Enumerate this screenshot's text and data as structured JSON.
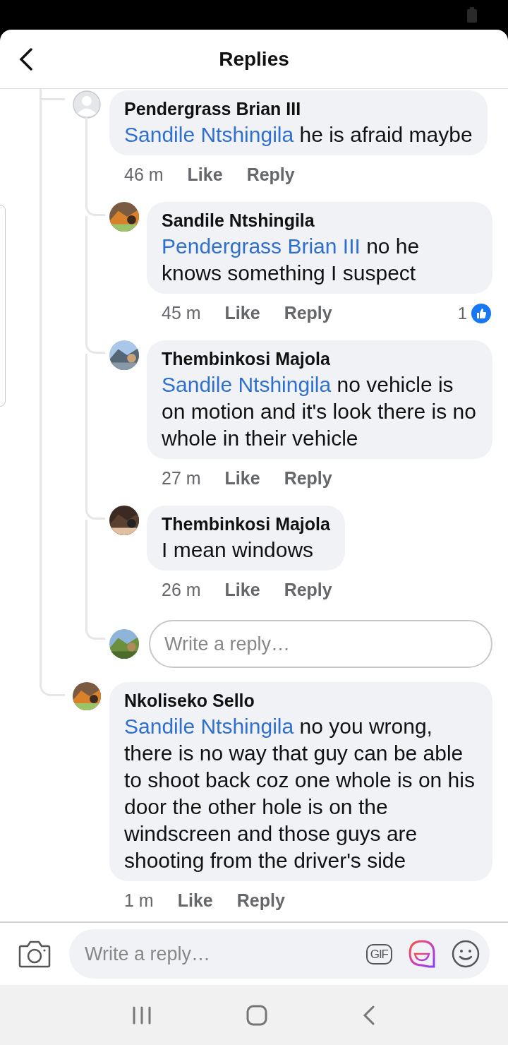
{
  "header": {
    "title": "Replies"
  },
  "comments": [
    {
      "has_photo": false,
      "author": "Pendergrass Brian III",
      "mention": "Sandile Ntshingila",
      "text": "he is afraid maybe",
      "time": "46 m",
      "actions": [
        "Like",
        "Reply"
      ],
      "children": [
        {
          "has_photo": true,
          "author": "Sandile Ntshingila",
          "mention": "Pendergrass Brian III",
          "text": "no he knows something I suspect",
          "time": "45 m",
          "actions": [
            "Like",
            "Reply"
          ],
          "reactions": "1"
        },
        {
          "has_photo": true,
          "author": "Thembinkosi Majola",
          "mention": "Sandile Ntshingila",
          "text": "no vehicle is on motion and it's look there is no whole in their vehicle",
          "time": "27 m",
          "actions": [
            "Like",
            "Reply"
          ]
        },
        {
          "has_photo": true,
          "author": "Thembinkosi Majola",
          "text": "I mean windows",
          "time": "26 m",
          "actions": [
            "Like",
            "Reply"
          ]
        }
      ],
      "reply_field": {
        "placeholder": "Write a reply…"
      }
    },
    {
      "has_photo": true,
      "author": "Nkoliseko Sello",
      "mention": "Sandile Ntshingila",
      "text": "no you wrong, there is no way that guy can be able to shoot back coz one whole is on his door the other hole is on the windscreen and those guys are shooting from the driver's side",
      "time": "1 m",
      "actions": [
        "Like",
        "Reply"
      ]
    }
  ],
  "composer": {
    "placeholder": "Write a reply…",
    "gif_label": "GIF"
  }
}
